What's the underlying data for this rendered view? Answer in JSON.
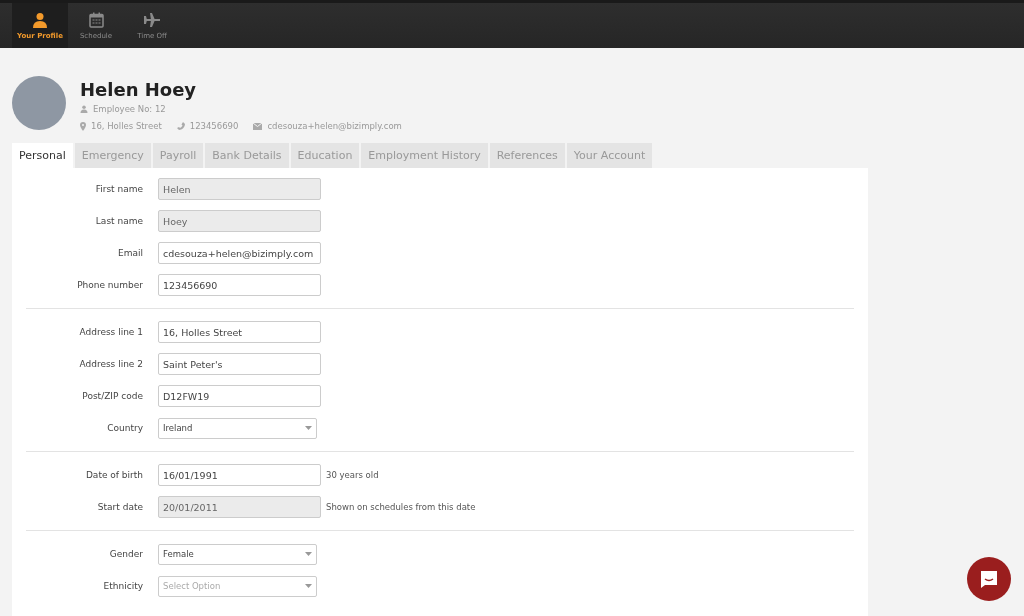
{
  "nav": [
    {
      "label": "Your Profile",
      "kind": "person",
      "selected": true
    },
    {
      "label": "Schedule",
      "kind": "calendar",
      "selected": false
    },
    {
      "label": "Time Off",
      "kind": "plane",
      "selected": false
    }
  ],
  "profile": {
    "name": "Helen Hoey",
    "employee_no": "Employee No: 12",
    "address": "16, Holles Street",
    "phone": "123456690",
    "email": "cdesouza+helen@bizimply.com"
  },
  "tabs": [
    {
      "label": "Personal",
      "selected": true
    },
    {
      "label": "Emergency",
      "selected": false
    },
    {
      "label": "Payroll",
      "selected": false
    },
    {
      "label": "Bank Details",
      "selected": false
    },
    {
      "label": "Education",
      "selected": false
    },
    {
      "label": "Employment History",
      "selected": false
    },
    {
      "label": "References",
      "selected": false
    },
    {
      "label": "Your Account",
      "selected": false
    }
  ],
  "sections": [
    {
      "fields": [
        {
          "label": "First name",
          "kind": "text",
          "value": "Helen",
          "disabled": true
        },
        {
          "label": "Last name",
          "kind": "text",
          "value": "Hoey",
          "disabled": true
        },
        {
          "label": "Email",
          "kind": "text",
          "value": "cdesouza+helen@bizimply.com",
          "disabled": false
        },
        {
          "label": "Phone number",
          "kind": "text",
          "value": "123456690",
          "disabled": false
        }
      ]
    },
    {
      "fields": [
        {
          "label": "Address line 1",
          "kind": "text",
          "value": "16, Holles Street",
          "disabled": false
        },
        {
          "label": "Address line 2",
          "kind": "text",
          "value": "Saint Peter's",
          "disabled": false
        },
        {
          "label": "Post/ZIP code",
          "kind": "text",
          "value": "D12FW19",
          "disabled": false
        },
        {
          "label": "Country",
          "kind": "select",
          "value": "Ireland",
          "disabled": false
        }
      ]
    },
    {
      "fields": [
        {
          "label": "Date of birth",
          "kind": "text",
          "value": "16/01/1991",
          "disabled": false,
          "note": "30 years old"
        },
        {
          "label": "Start date",
          "kind": "text",
          "value": "20/01/2011",
          "disabled": true,
          "note": "Shown on schedules from this date"
        }
      ]
    },
    {
      "fields": [
        {
          "label": "Gender",
          "kind": "select",
          "value": "Female",
          "disabled": false
        },
        {
          "label": "Ethnicity",
          "kind": "select",
          "placeholder": "Select Option",
          "disabled": false
        }
      ]
    }
  ]
}
